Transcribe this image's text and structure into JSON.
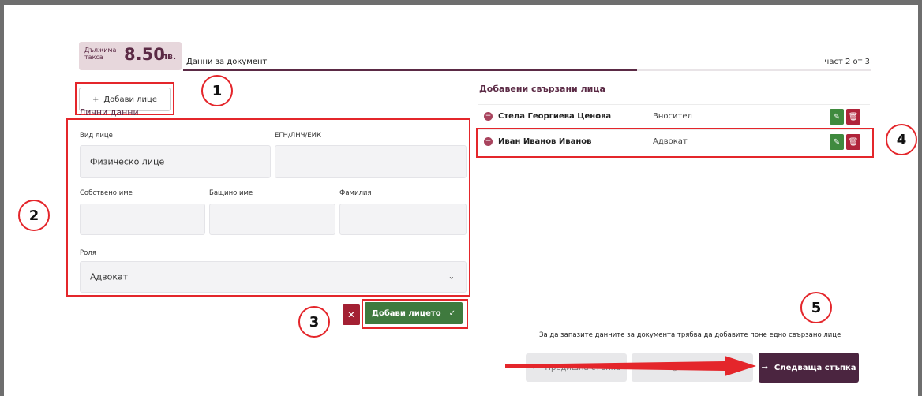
{
  "fee": {
    "label": "Дължима такса",
    "amount": "8.50",
    "currency": "лв."
  },
  "header": {
    "title": "Данни за документ",
    "step": "част 2 от 3",
    "progress": 0.66
  },
  "form": {
    "add_person_label": "Добави лице",
    "section_title": "Лични данни",
    "person_type_label": "Вид лице",
    "person_type_value": "Физическо лице",
    "egn_label": "ЕГН/ЛНЧ/ЕИК",
    "egn_value": "",
    "first_name_label": "Собствено име",
    "middle_name_label": "Бащино име",
    "last_name_label": "Фамилия",
    "role_label": "Роля",
    "role_value": "Адвокат",
    "save_person_label": "Добави лицето",
    "cancel_icon": "close-icon"
  },
  "related": {
    "title": "Добавени свързани лица",
    "items": [
      {
        "name": "Стела Георгиева Ценова",
        "role": "Вносител"
      },
      {
        "name": "Иван Иванов Иванов",
        "role": "Адвокат"
      }
    ]
  },
  "footer": {
    "hint": "За да запазите данните за документа трябва да добавите поне едно свързано лице",
    "prev_label": "Предишна стъпка",
    "mid_label": "Запази",
    "next_label": "Следваща стъпка"
  },
  "annotations": [
    "1",
    "2",
    "3",
    "4",
    "5"
  ],
  "colors": {
    "brand": "#5b2a45",
    "success": "#3f7a3e",
    "danger": "#a32033",
    "annotation": "#e4262b"
  }
}
